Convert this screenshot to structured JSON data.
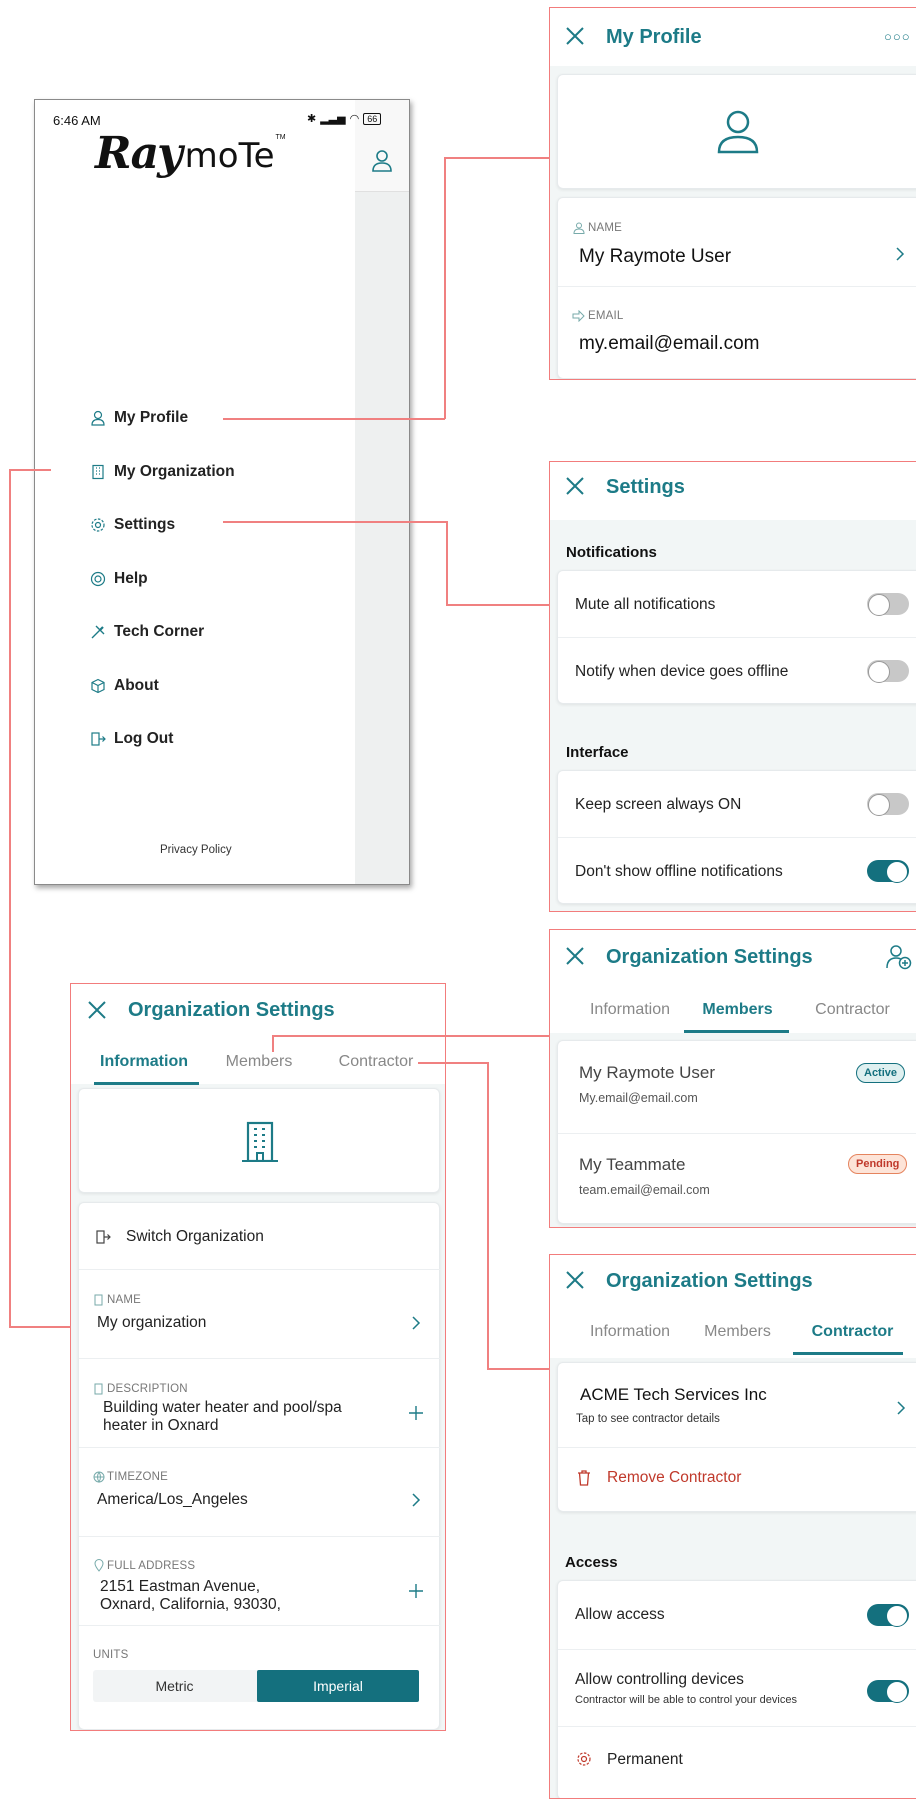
{
  "phone": {
    "time": "6:46 AM",
    "battery": "66",
    "logo_left": "Ray",
    "logo_right": "moTe",
    "logo_tm": "TM",
    "menu": [
      {
        "label": "My Profile",
        "icon": "person-icon"
      },
      {
        "label": "My Organization",
        "icon": "building-icon"
      },
      {
        "label": "Settings",
        "icon": "gear-icon"
      },
      {
        "label": "Help",
        "icon": "lifebuoy-icon"
      },
      {
        "label": "Tech Corner",
        "icon": "tools-icon"
      },
      {
        "label": "About",
        "icon": "box-icon"
      },
      {
        "label": "Log Out",
        "icon": "logout-icon"
      }
    ],
    "privacy": "Privacy Policy"
  },
  "profile": {
    "title": "My Profile",
    "name_label": "NAME",
    "name_value": "My Raymote User",
    "email_label": "EMAIL",
    "email_value": "my.email@email.com"
  },
  "settings": {
    "title": "Settings",
    "notifications_header": "Notifications",
    "mute_label": "Mute all notifications",
    "offline_label": "Notify when device goes offline",
    "interface_header": "Interface",
    "screen_label": "Keep screen always ON",
    "offline_notif_label": "Don't show offline notifications"
  },
  "org_info": {
    "title": "Organization Settings",
    "tabs": [
      "Information",
      "Members",
      "Contractor"
    ],
    "switch_label": "Switch Organization",
    "name_label": "NAME",
    "name_value": "My organization",
    "desc_label": "DESCRIPTION",
    "desc_line1": "Building water heater and pool/spa",
    "desc_line2": "heater in Oxnard",
    "tz_label": "TIMEZONE",
    "tz_value": "America/Los_Angeles",
    "addr_label": "FULL ADDRESS",
    "addr_line1": "2151 Eastman Avenue,",
    "addr_line2": "Oxnard, California, 93030,",
    "units_label": "UNITS",
    "unit_metric": "Metric",
    "unit_imperial": "Imperial"
  },
  "org_members": {
    "title": "Organization Settings",
    "tabs": [
      "Information",
      "Members",
      "Contractor"
    ],
    "members": [
      {
        "name": "My Raymote User",
        "email": "My.email@email.com",
        "status": "Active"
      },
      {
        "name": "My Teammate",
        "email": "team.email@email.com",
        "status": "Pending"
      }
    ]
  },
  "org_contractor": {
    "title": "Organization Settings",
    "tabs": [
      "Information",
      "Members",
      "Contractor"
    ],
    "contractor_name": "ACME Tech Services Inc",
    "contractor_hint": "Tap to see contractor details",
    "remove_label": "Remove Contractor",
    "access_header": "Access",
    "allow_access": "Allow access",
    "allow_control": "Allow controlling devices",
    "allow_control_hint": "Contractor will be able to control your devices",
    "permanent": "Permanent"
  },
  "colors": {
    "accent": "#1d7b87",
    "connector": "#f08080",
    "danger": "#c0392b"
  }
}
